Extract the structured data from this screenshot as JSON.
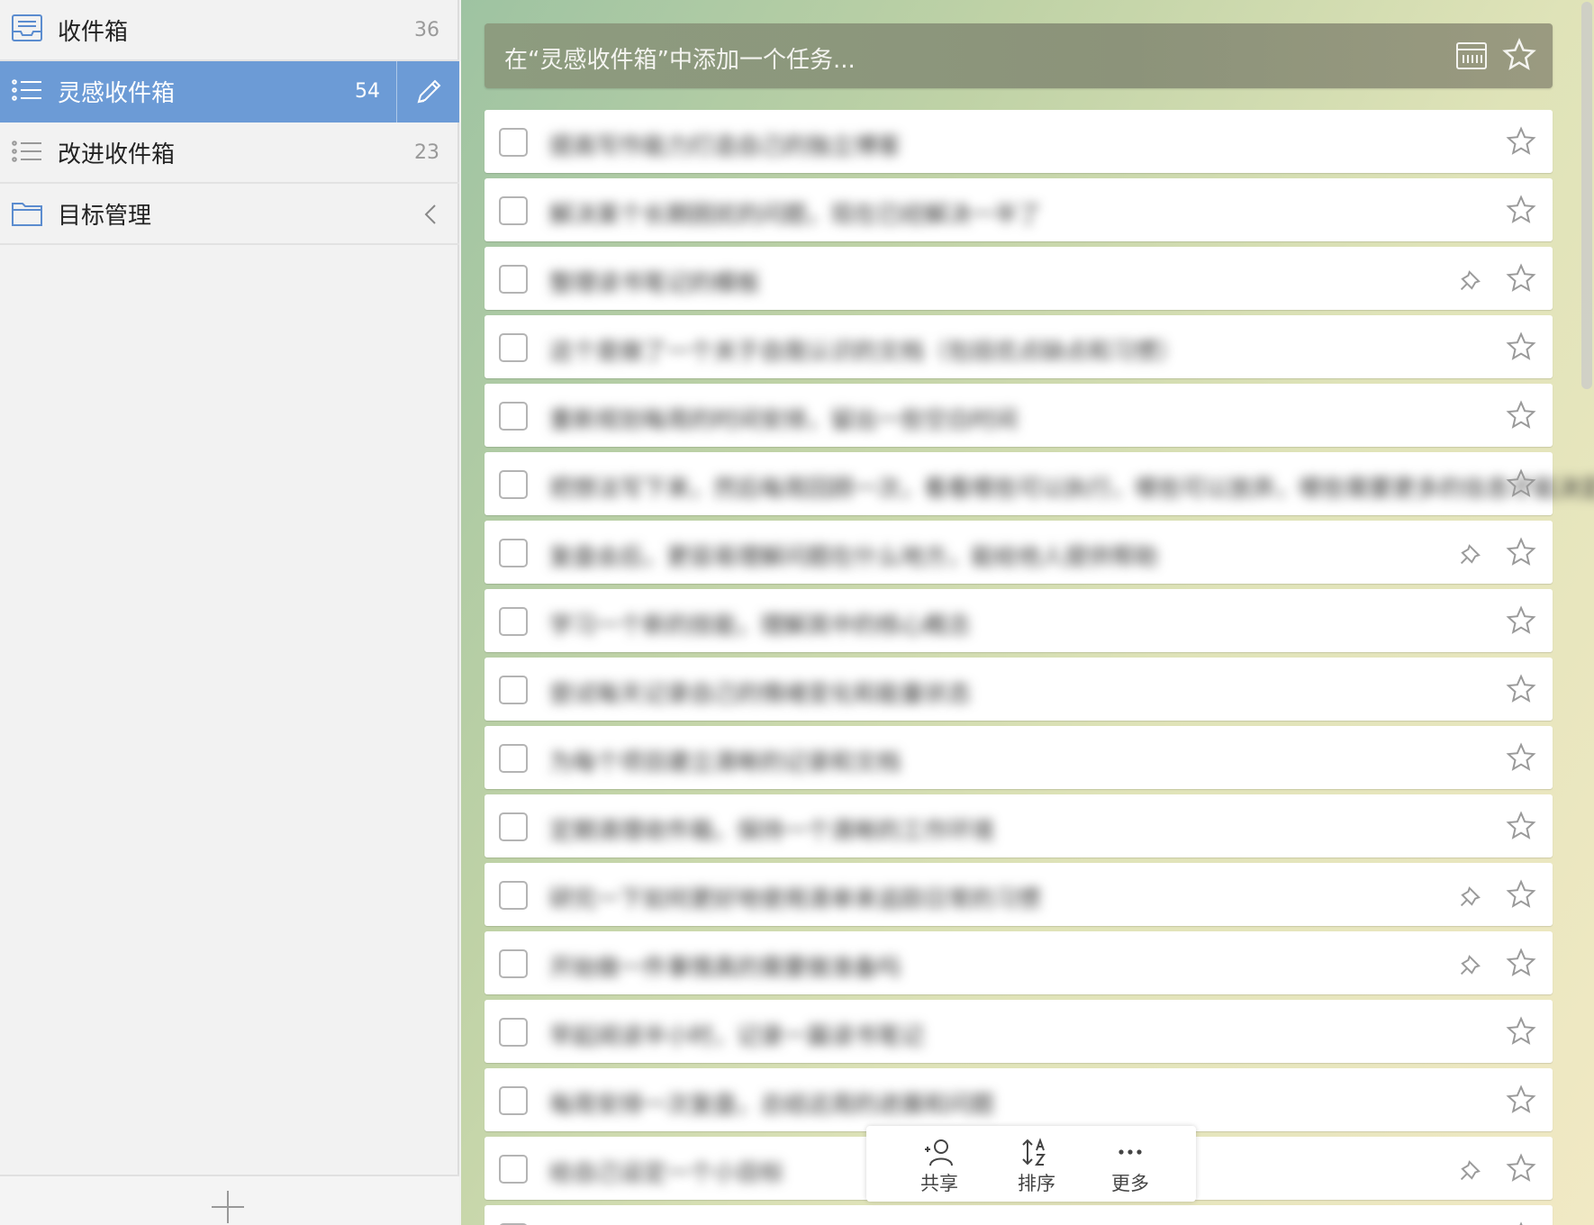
{
  "sidebar": {
    "items": [
      {
        "label": "收件箱",
        "count": "36",
        "icon": "inbox-icon"
      },
      {
        "label": "灵感收件箱",
        "count": "54",
        "icon": "list-icon",
        "active": true
      },
      {
        "label": "改进收件箱",
        "count": "23",
        "icon": "list-icon"
      },
      {
        "label": "目标管理",
        "count": "",
        "icon": "folder-icon"
      }
    ]
  },
  "main": {
    "add_placeholder": "在“灵感收件箱”中添加一个任务...",
    "tasks": [
      {
        "title": "提高写作能力打造自己的独立博客",
        "pinned": false
      },
      {
        "title": "解决某个长期困扰的问题，现在已经解决一半了",
        "pinned": false
      },
      {
        "title": "整理读书笔记的模板",
        "pinned": true
      },
      {
        "title": "这个是做了一个关于自我认识的文档（包括优点缺点和习惯）",
        "pinned": false
      },
      {
        "title": "重新规划每周的时间安排，留出一些空白时间",
        "pinned": false
      },
      {
        "title": "把想法写下来，然后每周回顾一次，看看哪些可以执行，哪些可以放弃，哪些需要更多的信息才能决定",
        "pinned": false
      },
      {
        "title": "复盘会后，更容易理解问题在什么地方，能给他人提供帮助",
        "pinned": true
      },
      {
        "title": "学习一个新的技能，理解其中的核心概念",
        "pinned": false
      },
      {
        "title": "尝试每天记录自己的情绪变化和能量状态",
        "pinned": false
      },
      {
        "title": "为每个项目建立清晰的记录和文档",
        "pinned": false
      },
      {
        "title": "定期清理收件箱，保持一个清晰的工作环境",
        "pinned": false
      },
      {
        "title": "研究一下如何更好地使用清单来追踪日常的习惯",
        "pinned": true
      },
      {
        "title": "开始做一件事情真的需要做准备吗",
        "pinned": true
      },
      {
        "title": "早起阅读半小时，记录一篇读书笔记",
        "pinned": false
      },
      {
        "title": "每周安排一次复盘，总结这周的进展和问题",
        "pinned": false
      },
      {
        "title": "给自己设定一个小目标",
        "pinned": true
      },
      {
        "title": "",
        "pinned": false
      }
    ]
  },
  "toolbar": {
    "share_label": "共享",
    "sort_label": "排序",
    "more_label": "更多"
  },
  "colors": {
    "sidebar_active": "#6c9bd6",
    "accent_icon": "#5b8ccf",
    "add_bar": "#8c937a"
  }
}
